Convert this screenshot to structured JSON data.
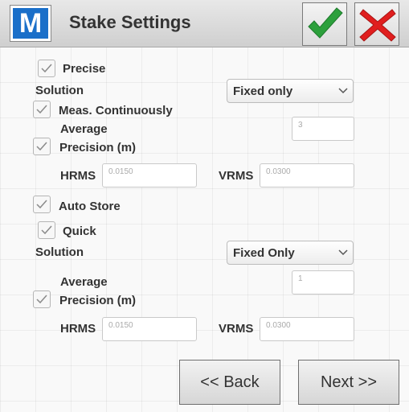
{
  "header": {
    "logo_letter": "M",
    "title": "Stake Settings"
  },
  "precise": {
    "label": "Precise",
    "solution_label": "Solution",
    "solution_value": "Fixed only",
    "meas_continuously_label": "Meas. Continuously",
    "average_label": "Average",
    "average_value": "3",
    "precision_label": "Precision (m)",
    "hrms_label": "HRMS",
    "hrms_value": "0.0150",
    "vrms_label": "VRMS",
    "vrms_value": "0.0300"
  },
  "auto_store": {
    "label": "Auto Store"
  },
  "quick": {
    "label": "Quick",
    "solution_label": "Solution",
    "solution_value": "Fixed Only",
    "average_label": "Average",
    "average_value": "1",
    "precision_label": "Precision (m)",
    "hrms_label": "HRMS",
    "hrms_value": "0.0150",
    "vrms_label": "VRMS",
    "vrms_value": "0.0300"
  },
  "footer": {
    "back_label": "<< Back",
    "next_label": "Next >>"
  },
  "colors": {
    "accept": "#2ca03c",
    "cancel": "#e01e1e",
    "logo": "#1a6fc9"
  }
}
